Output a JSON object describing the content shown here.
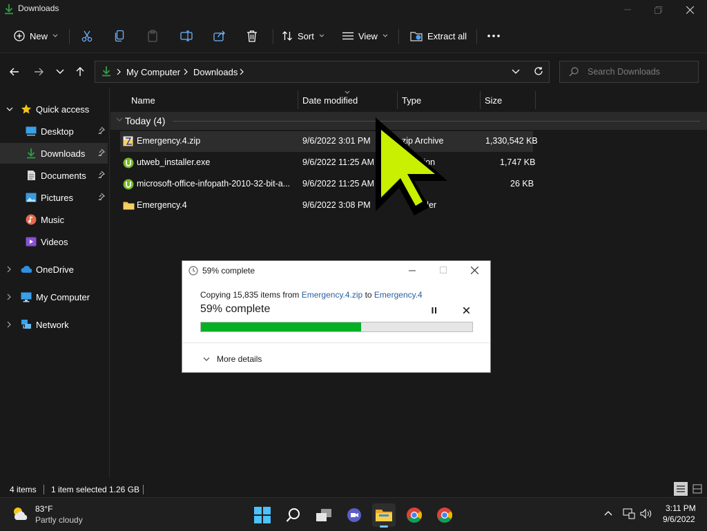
{
  "window": {
    "title": "Downloads"
  },
  "commandbar": {
    "new_label": "New",
    "sort_label": "Sort",
    "view_label": "View",
    "extract_label": "Extract all"
  },
  "address": {
    "crumbs": [
      "My Computer",
      "Downloads"
    ],
    "search_placeholder": "Search Downloads"
  },
  "nav": {
    "quick_access": "Quick access",
    "items": [
      {
        "label": "Desktop",
        "icon": "desktop-icon",
        "pinned": true
      },
      {
        "label": "Downloads",
        "icon": "download-icon",
        "pinned": true,
        "selected": true
      },
      {
        "label": "Documents",
        "icon": "document-icon",
        "pinned": true
      },
      {
        "label": "Pictures",
        "icon": "pictures-icon",
        "pinned": true
      },
      {
        "label": "Music",
        "icon": "music-icon",
        "pinned": false
      },
      {
        "label": "Videos",
        "icon": "videos-icon",
        "pinned": false
      }
    ],
    "roots": [
      {
        "label": "OneDrive",
        "icon": "cloud-icon"
      },
      {
        "label": "My Computer",
        "icon": "monitor-icon"
      },
      {
        "label": "Network",
        "icon": "network-icon"
      }
    ]
  },
  "files": {
    "columns": [
      "Name",
      "Date modified",
      "Type",
      "Size"
    ],
    "group_label": "Today (4)",
    "rows": [
      {
        "name": "Emergency.4.zip",
        "date": "9/6/2022 3:01 PM",
        "type": "zip Archive",
        "size": "1,330,542 KB",
        "icon": "zip-icon",
        "selected": true
      },
      {
        "name": "utweb_installer.exe",
        "date": "9/6/2022 11:25 AM",
        "type": "ication",
        "size": "1,747 KB",
        "icon": "utorrent-icon"
      },
      {
        "name": "microsoft-office-infopath-2010-32-bit-a...",
        "date": "9/6/2022 11:25 AM",
        "type": "",
        "size": "26 KB",
        "icon": "utorrent-icon"
      },
      {
        "name": "Emergency.4",
        "date": "9/6/2022 3:08 PM",
        "type": "der",
        "size": "",
        "icon": "folder-icon"
      }
    ]
  },
  "dialog": {
    "title": "59% complete",
    "copy_prefix": "Copying 15,835 items from ",
    "source": "Emergency.4.zip",
    "to_word": " to ",
    "destination": "Emergency.4",
    "progress_label": "59% complete",
    "progress_percent": 59,
    "more_details": "More details"
  },
  "status": {
    "items": "4 items",
    "selected": "1 item selected",
    "size": "1.26 GB"
  },
  "taskbar": {
    "weather_temp": "83°F",
    "weather_desc": "Partly cloudy",
    "time": "3:11 PM",
    "date": "9/6/2022"
  },
  "colors": {
    "accent_green": "#06b025",
    "cursor_fill": "#c8f000",
    "link_blue": "#2a5f9c"
  }
}
